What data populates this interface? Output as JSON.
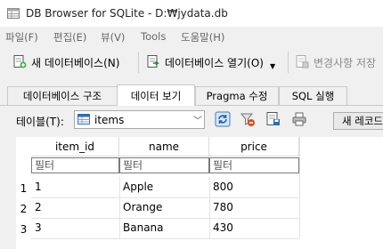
{
  "window": {
    "title": "DB Browser for SQLite - D:₩jydata.db"
  },
  "menu": [
    "파일(F)",
    "편집(E)",
    "뷰(V)",
    "Tools",
    "도움말(H)"
  ],
  "toolbar": {
    "new_db": "새 데이터베이스(N)",
    "open_db": "데이터베이스 열기(O)",
    "write_changes": "변경사항 저장"
  },
  "tabs": [
    "데이터베이스 구조",
    "데이터 보기",
    "Pragma 수정",
    "SQL 실행"
  ],
  "browse": {
    "table_label": "테이블(T):",
    "table_value": "items",
    "new_record": "새 레코드"
  },
  "grid": {
    "columns": [
      "item_id",
      "name",
      "price"
    ],
    "filter_placeholder": "필터",
    "row_numbers": [
      "1",
      "2",
      "3"
    ],
    "rows": [
      [
        "1",
        "Apple",
        "800"
      ],
      [
        "2",
        "Orange",
        "780"
      ],
      [
        "3",
        "Banana",
        "430"
      ]
    ]
  }
}
